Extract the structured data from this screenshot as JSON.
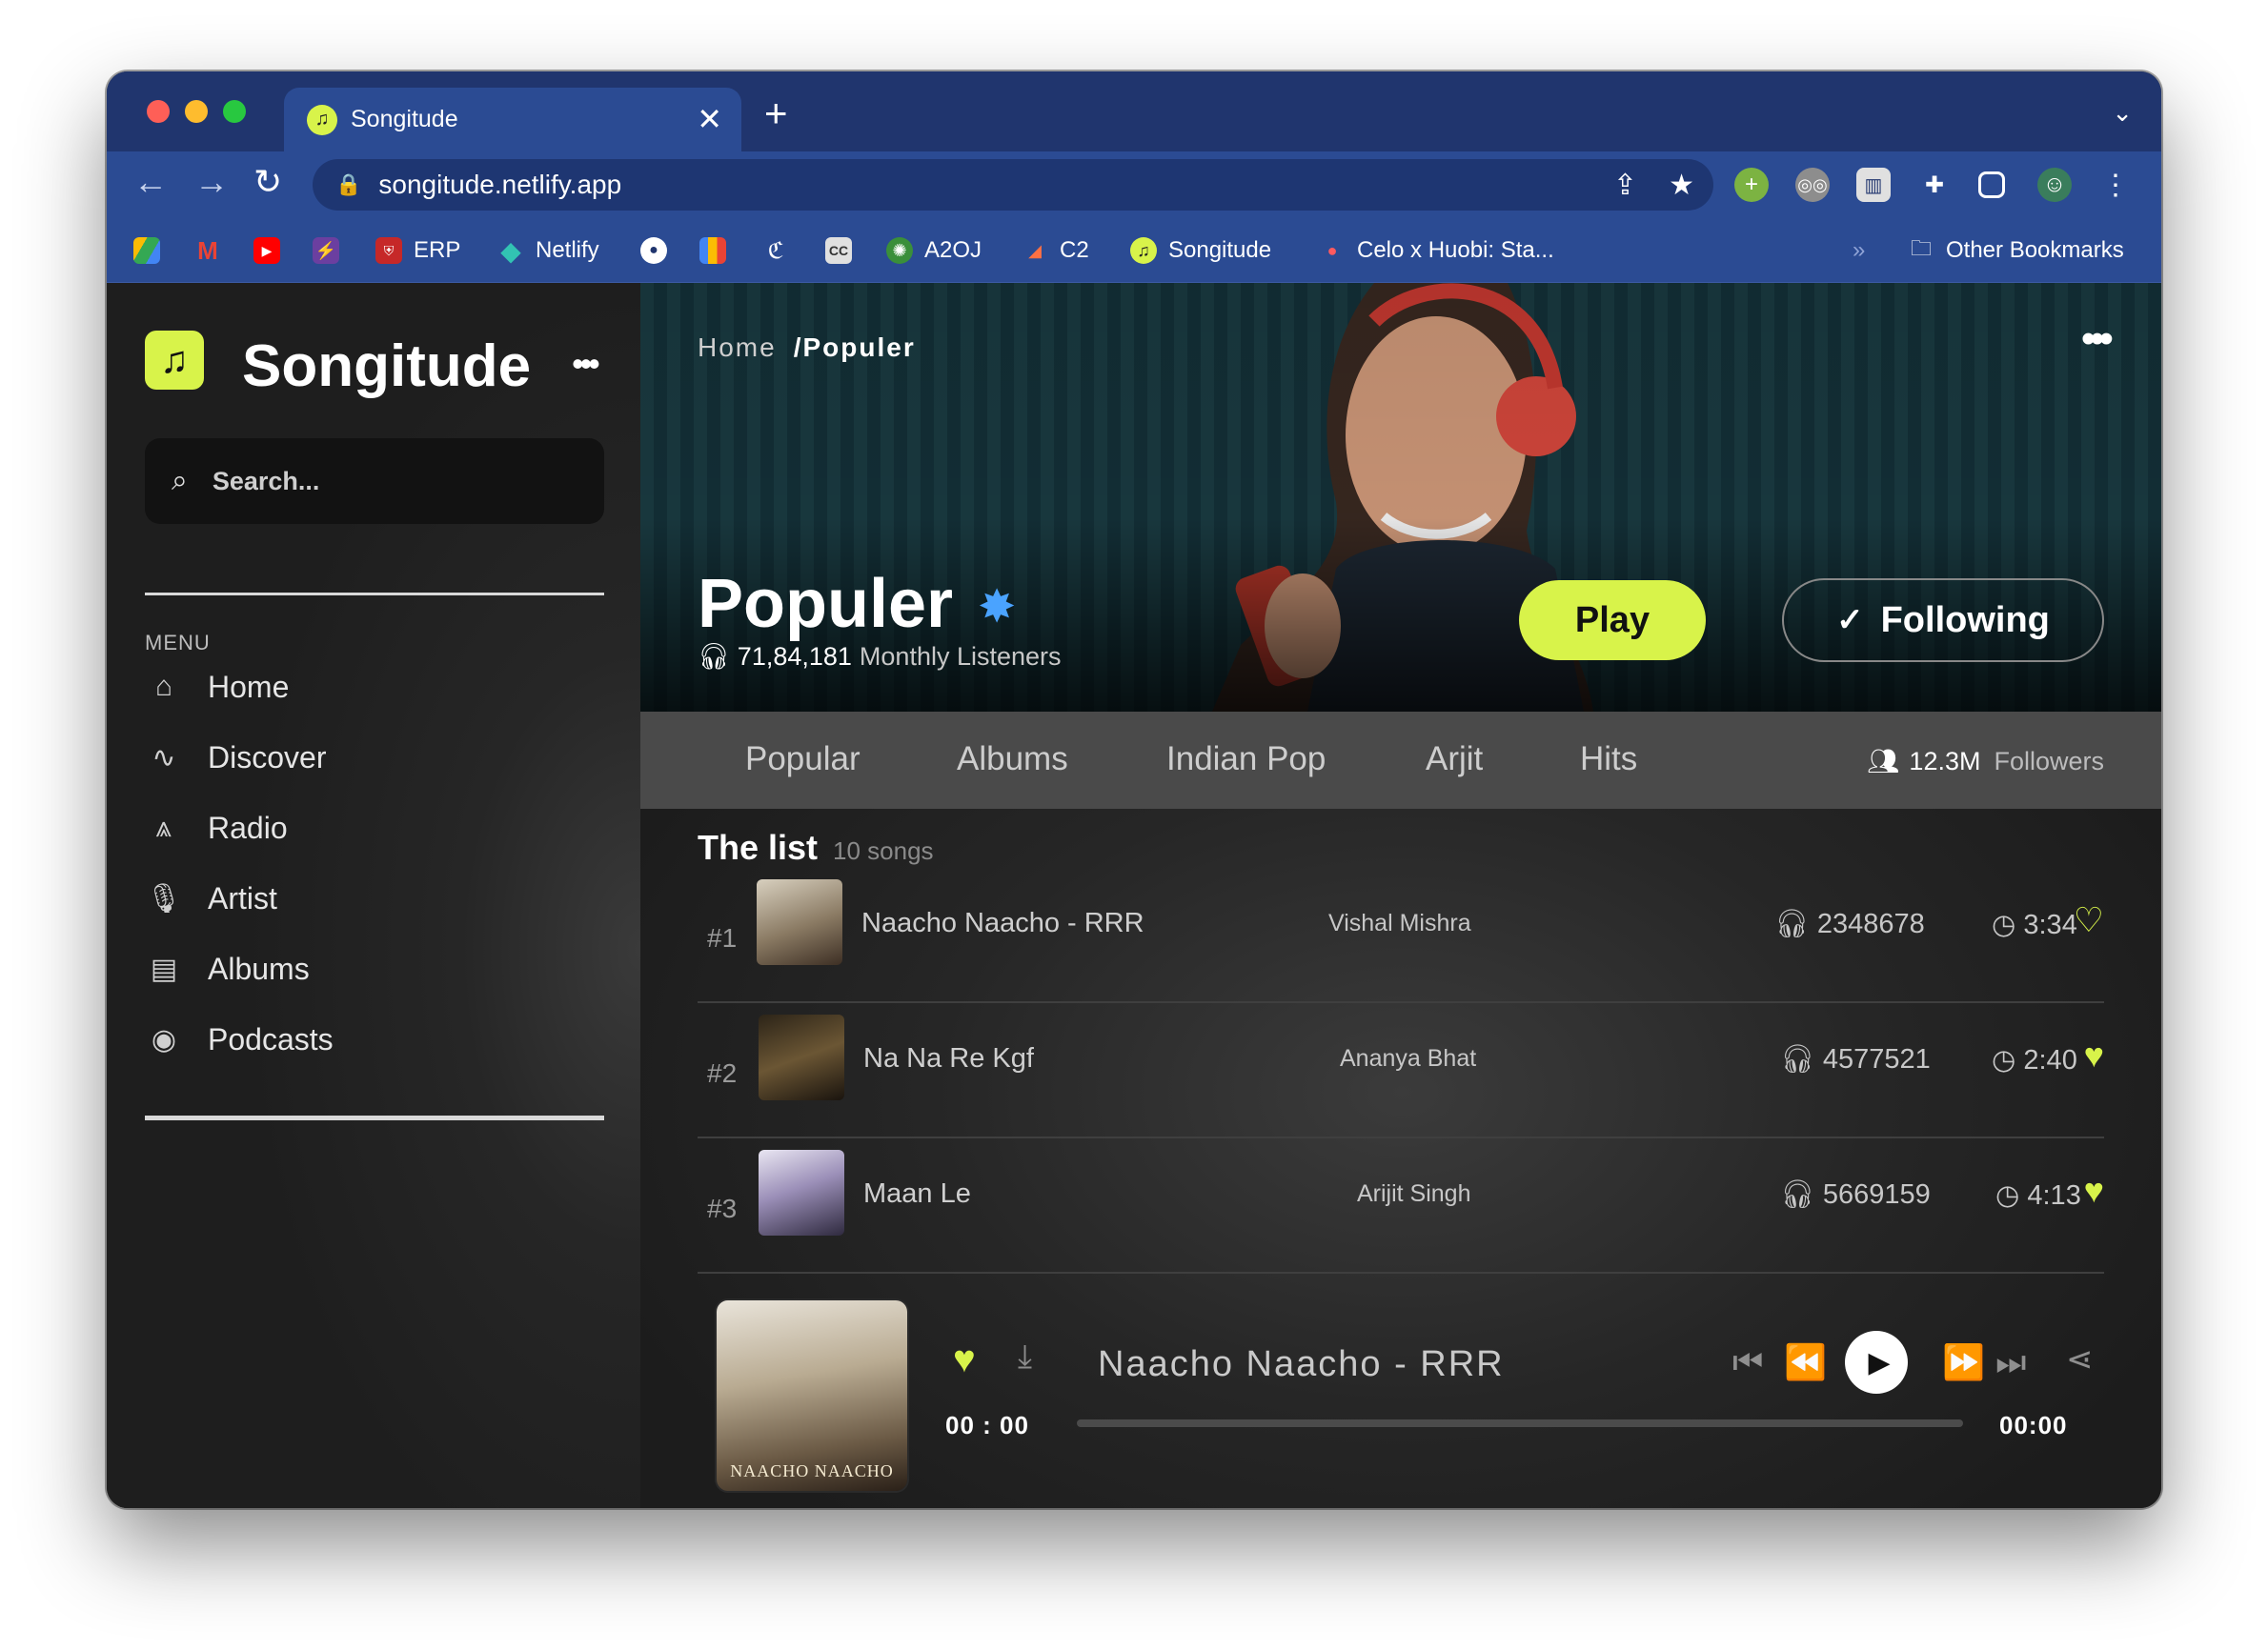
{
  "browser": {
    "tab_title": "Songitude",
    "url": "songitude.netlify.app",
    "bookmarks": [
      {
        "label": "",
        "icon": "drive-icon"
      },
      {
        "label": "",
        "icon": "gmail-icon"
      },
      {
        "label": "",
        "icon": "youtube-icon"
      },
      {
        "label": "",
        "icon": "bolt-icon"
      },
      {
        "label": "ERP",
        "icon": "erp-icon"
      },
      {
        "label": "Netlify",
        "icon": "netlify-icon"
      },
      {
        "label": "",
        "icon": "github-icon"
      },
      {
        "label": "",
        "icon": "chart-icon"
      },
      {
        "label": "",
        "icon": "codechef-icon"
      },
      {
        "label": "",
        "icon": "cc-icon"
      },
      {
        "label": "A2OJ",
        "icon": "a2oj-icon"
      },
      {
        "label": "C2",
        "icon": "c2-icon"
      },
      {
        "label": "Songitude",
        "icon": "songitude-icon"
      },
      {
        "label": "Celo x Huobi: Sta...",
        "icon": "celo-icon"
      }
    ],
    "other_bookmarks": "Other Bookmarks",
    "overflow": "»"
  },
  "sidebar": {
    "brand": "Songitude",
    "more": "•••",
    "search_placeholder": "Search...",
    "menu_label": "MENU",
    "items": [
      {
        "label": "Home",
        "icon": "home-icon"
      },
      {
        "label": "Discover",
        "icon": "pulse-icon"
      },
      {
        "label": "Radio",
        "icon": "radio-icon"
      },
      {
        "label": "Artist",
        "icon": "microphone-icon"
      },
      {
        "label": "Albums",
        "icon": "album-icon"
      },
      {
        "label": "Podcasts",
        "icon": "podcast-icon"
      }
    ]
  },
  "hero": {
    "breadcrumb_home": "Home",
    "breadcrumb_current": "/Populer",
    "more": "•••",
    "artist_name": "Populer",
    "listeners_count": "71,84,181",
    "listeners_label": "Monthly Listeners",
    "play_label": "Play",
    "following_label": "Following"
  },
  "tabs": {
    "items": [
      "Popular",
      "Albums",
      "Indian Pop",
      "Arjit",
      "Hits"
    ],
    "followers_count": "12.3M",
    "followers_label": "Followers"
  },
  "list": {
    "title": "The list",
    "count": "10 songs",
    "rows": [
      {
        "rank": "#1",
        "song": "Naacho Naacho - RRR",
        "artist": "Vishal Mishra",
        "plays": "2348678",
        "duration": "3:34",
        "liked": false
      },
      {
        "rank": "#2",
        "song": "Na Na Re Kgf",
        "artist": "Ananya Bhat",
        "plays": "4577521",
        "duration": "2:40",
        "liked": true
      },
      {
        "rank": "#3",
        "song": "Maan Le",
        "artist": "Arijit Singh",
        "plays": "5669159",
        "duration": "4:13",
        "liked": true
      }
    ]
  },
  "player": {
    "title": "Naacho Naacho - RRR",
    "cover_text": "NAACHO NAACHO",
    "current_time": "00 : 00",
    "total_time": "00:00",
    "progress": 0
  },
  "colors": {
    "accent": "#d8f34a",
    "browser_frame": "#20356e",
    "verified": "#4aa3ff"
  }
}
